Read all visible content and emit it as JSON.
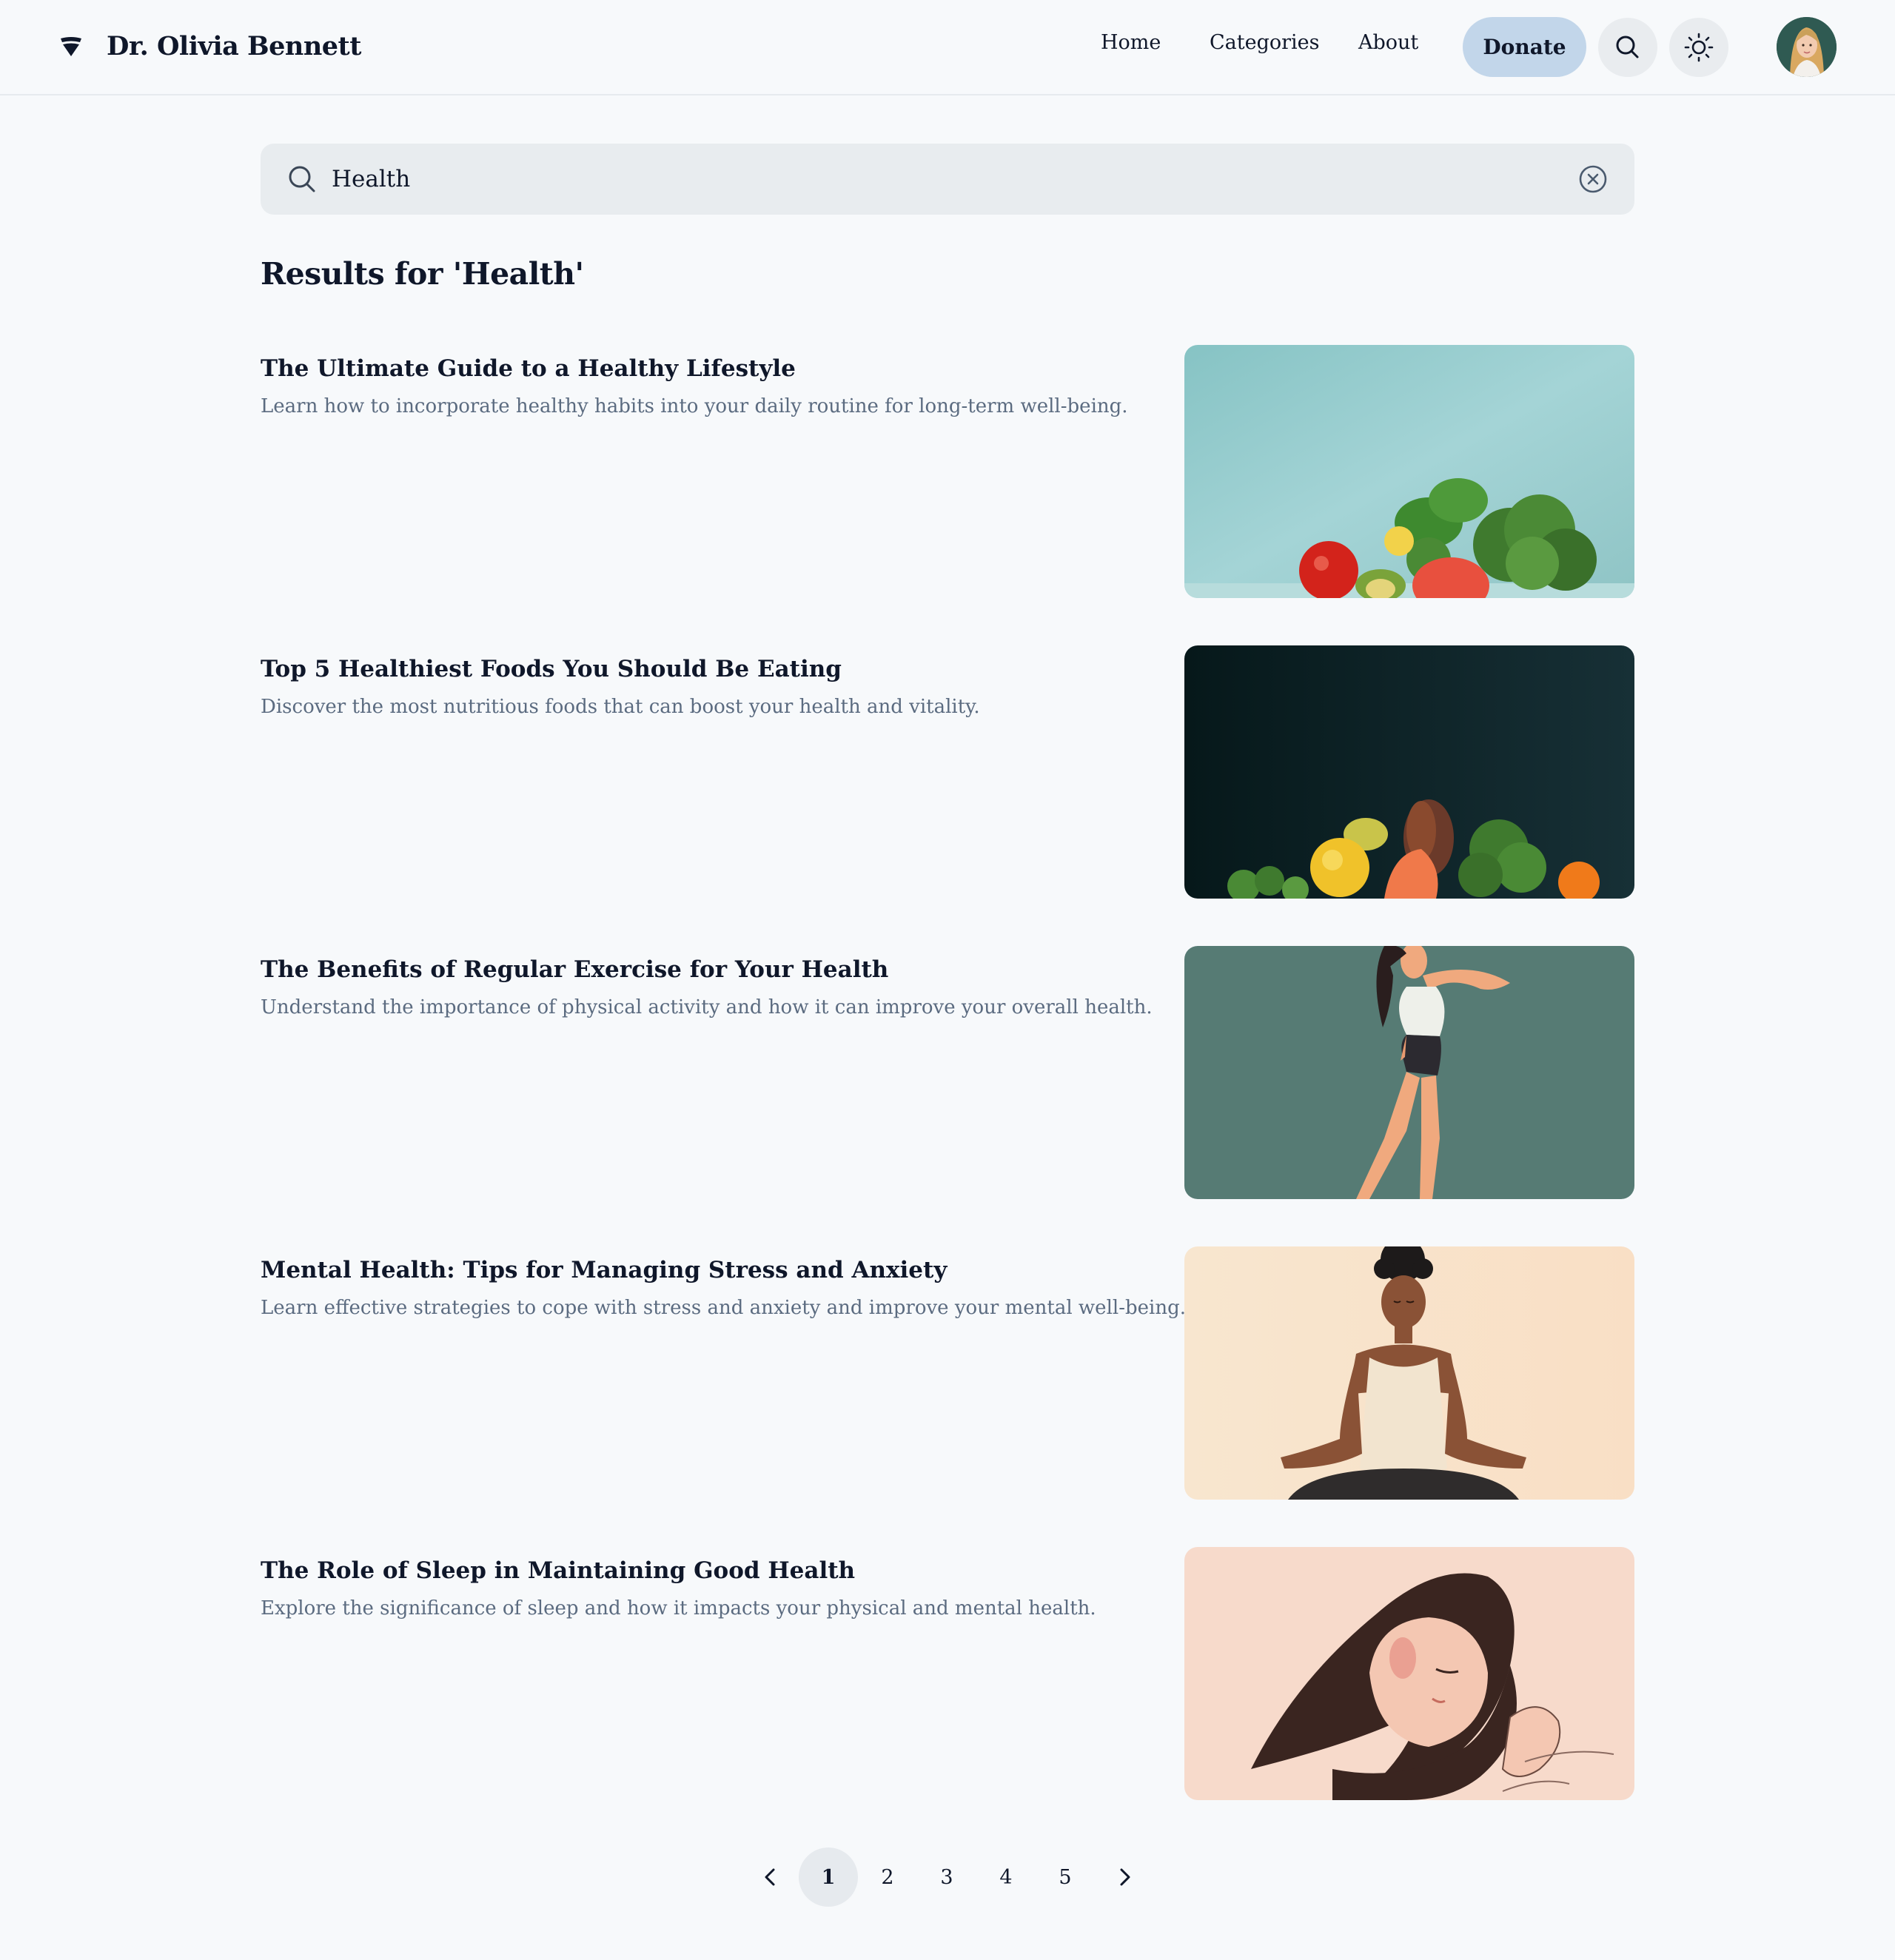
{
  "header": {
    "brand_name": "Dr. Olivia Bennett",
    "nav": [
      "Home",
      "Categories",
      "About"
    ],
    "donate_label": "Donate"
  },
  "search": {
    "value": "Health",
    "placeholder": "Search"
  },
  "results_title": "Results for 'Health'",
  "results": [
    {
      "title": "The Ultimate Guide to a Healthy Lifestyle",
      "description": "Learn how to incorporate healthy habits into your daily routine for long-term well-being.",
      "image": "vegetables-on-teal"
    },
    {
      "title": "Top 5 Healthiest Foods You Should Be Eating",
      "description": "Discover the most nutritious foods that can boost your health and vitality.",
      "image": "foods-on-dark"
    },
    {
      "title": "The Benefits of Regular Exercise for Your Health",
      "description": "Understand the importance of physical activity and how it can improve your overall health.",
      "image": "woman-exercising"
    },
    {
      "title": "Mental Health: Tips for Managing Stress and Anxiety",
      "description": "Learn effective strategies to cope with stress and anxiety and improve your mental well-being.",
      "image": "woman-meditating"
    },
    {
      "title": "The Role of Sleep in Maintaining Good Health",
      "description": "Explore the significance of sleep and how it impacts your physical and mental health.",
      "image": "woman-sleeping"
    }
  ],
  "pagination": {
    "pages": [
      "1",
      "2",
      "3",
      "4",
      "5"
    ],
    "current": "1"
  },
  "colors": {
    "background": "#f7f9fb",
    "donate": "#c2d6ea",
    "muted_text": "#5b6b80",
    "search_bg": "#e8ecef"
  },
  "icons": [
    "logo-icon",
    "search-icon",
    "sun-icon",
    "clear-icon",
    "chevron-left-icon",
    "chevron-right-icon"
  ]
}
